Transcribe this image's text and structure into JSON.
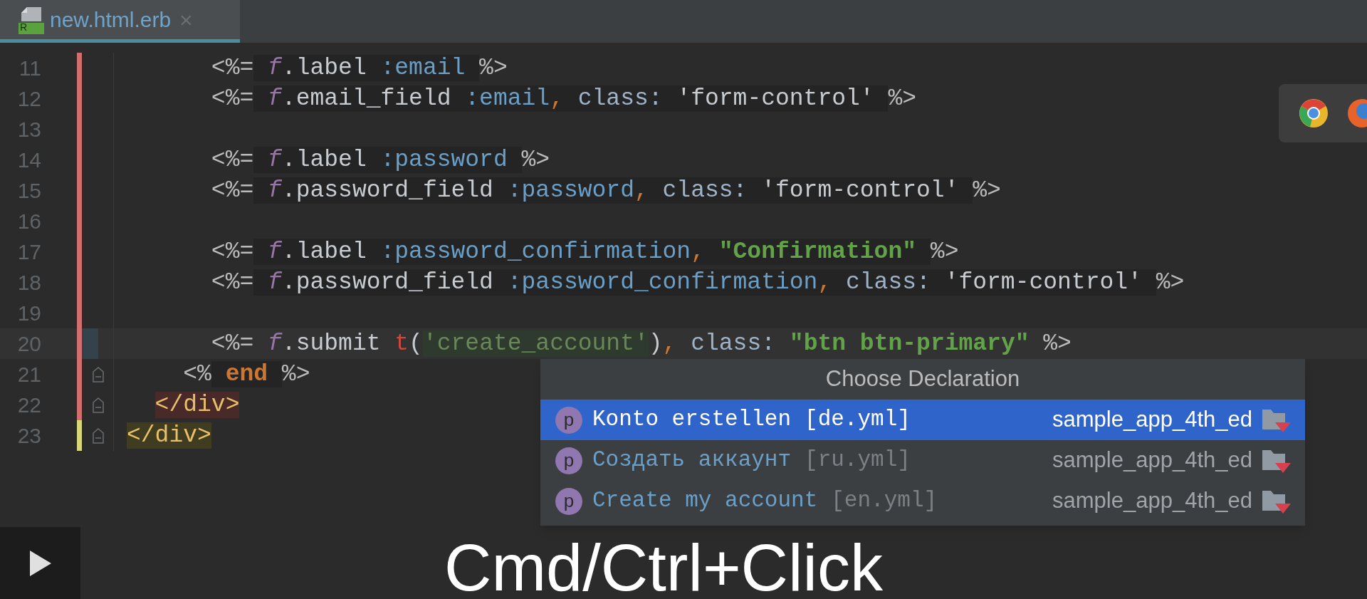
{
  "tab": {
    "title": "new.html.erb",
    "badge": "R",
    "close": "×",
    "selected": true
  },
  "lines": [
    {
      "number": "11",
      "color": "#d26e6e",
      "current": false,
      "fold": false,
      "tokens": [
        {
          "text": "      <%=",
          "kind": "delim"
        },
        {
          "text": " f",
          "kind": "var"
        },
        {
          "text": ".label ",
          "kind": "plain"
        },
        {
          "text": ":email ",
          "kind": "symbol"
        },
        {
          "text": "%>",
          "kind": "delim"
        }
      ]
    },
    {
      "number": "12",
      "color": "#d26e6e",
      "current": false,
      "fold": false,
      "tokens": [
        {
          "text": "      <%=",
          "kind": "delim"
        },
        {
          "text": " f",
          "kind": "var"
        },
        {
          "text": ".email_field ",
          "kind": "plain"
        },
        {
          "text": ":email",
          "kind": "symbol"
        },
        {
          "text": ",",
          "kind": "comma"
        },
        {
          "text": " class: ",
          "kind": "key"
        },
        {
          "text": "'form-control' ",
          "kind": "plain"
        },
        {
          "text": "%>",
          "kind": "delim"
        }
      ]
    },
    {
      "number": "13",
      "color": "#d26e6e",
      "current": false,
      "fold": false
    },
    {
      "number": "14",
      "color": "#d26e6e",
      "current": false,
      "fold": false,
      "tokens": [
        {
          "text": "      <%=",
          "kind": "delim"
        },
        {
          "text": " f",
          "kind": "var"
        },
        {
          "text": ".label ",
          "kind": "plain"
        },
        {
          "text": ":password ",
          "kind": "symbol"
        },
        {
          "text": "%>",
          "kind": "delim"
        }
      ]
    },
    {
      "number": "15",
      "color": "#d26e6e",
      "current": false,
      "fold": false,
      "tokens": [
        {
          "text": "      <%=",
          "kind": "delim"
        },
        {
          "text": " f",
          "kind": "var"
        },
        {
          "text": ".password_field ",
          "kind": "plain"
        },
        {
          "text": ":password",
          "kind": "symbol"
        },
        {
          "text": ",",
          "kind": "comma"
        },
        {
          "text": " class: ",
          "kind": "key"
        },
        {
          "text": "'form-control' ",
          "kind": "plain"
        },
        {
          "text": "%>",
          "kind": "delim"
        }
      ]
    },
    {
      "number": "16",
      "color": "#d26e6e",
      "current": false,
      "fold": false
    },
    {
      "number": "17",
      "color": "#d26e6e",
      "current": false,
      "fold": false,
      "tokens": [
        {
          "text": "      <%=",
          "kind": "delim"
        },
        {
          "text": " f",
          "kind": "var"
        },
        {
          "text": ".label ",
          "kind": "plain"
        },
        {
          "text": ":password_confirmation",
          "kind": "symbol"
        },
        {
          "text": ", ",
          "kind": "comma"
        },
        {
          "text": "\"Confirmation\" ",
          "kind": "strong"
        },
        {
          "text": "%>",
          "kind": "delim"
        }
      ]
    },
    {
      "number": "18",
      "color": "#d26e6e",
      "current": false,
      "fold": false,
      "tokens": [
        {
          "text": "      <%=",
          "kind": "delim"
        },
        {
          "text": " f",
          "kind": "var"
        },
        {
          "text": ".password_field ",
          "kind": "plain"
        },
        {
          "text": ":password_confirmation",
          "kind": "symbol"
        },
        {
          "text": ",",
          "kind": "comma"
        },
        {
          "text": " class: ",
          "kind": "key"
        },
        {
          "text": "'form-control' ",
          "kind": "plain"
        },
        {
          "text": "%>",
          "kind": "delim"
        }
      ]
    },
    {
      "number": "19",
      "color": "#d26e6e",
      "current": false,
      "fold": false
    },
    {
      "number": "20",
      "color": "#d26e6e",
      "current": true,
      "fold": false,
      "tokens": [
        {
          "text": "      <%=",
          "kind": "delim"
        },
        {
          "text": " f",
          "kind": "var"
        },
        {
          "text": ".submit ",
          "kind": "plain"
        },
        {
          "text": "t",
          "kind": "call"
        },
        {
          "text": "(",
          "kind": "plain"
        },
        {
          "text": "'create_account'",
          "kind": "literal"
        },
        {
          "text": ")",
          "kind": "plain"
        },
        {
          "text": ",",
          "kind": "comma"
        },
        {
          "text": " class: ",
          "kind": "key"
        },
        {
          "text": "\"btn btn-primary\" ",
          "kind": "strong"
        },
        {
          "text": "%>",
          "kind": "delim"
        }
      ]
    },
    {
      "number": "21",
      "color": "#d26e6e",
      "current": false,
      "fold": true,
      "tokens": [
        {
          "text": "    <%",
          "kind": "delim"
        },
        {
          "text": " end ",
          "kind": "keyword"
        },
        {
          "text": "%>",
          "kind": "delim"
        }
      ]
    },
    {
      "number": "22",
      "color": "#d26e6e",
      "current": false,
      "fold": true,
      "tokens": [
        {
          "text": "  </div>",
          "kind": "tagerr"
        }
      ]
    },
    {
      "number": "23",
      "color": "#d7d77a",
      "current": false,
      "fold": true,
      "tokens": [
        {
          "text": "</div>",
          "kind": "tagok"
        }
      ]
    }
  ],
  "popup": {
    "title": "Choose Declaration",
    "items": [
      {
        "badge": "p",
        "name": "Konto erstellen",
        "file": "[de.yml]",
        "project": "sample_app_4th_ed",
        "selected": true
      },
      {
        "badge": "p",
        "name": "Создать аккаунт",
        "file": "[ru.yml]",
        "project": "sample_app_4th_ed",
        "selected": false
      },
      {
        "badge": "p",
        "name": "Create my account",
        "file": "[en.yml]",
        "project": "sample_app_4th_ed",
        "selected": false
      }
    ]
  },
  "caption": "Cmd/Ctrl+Click"
}
